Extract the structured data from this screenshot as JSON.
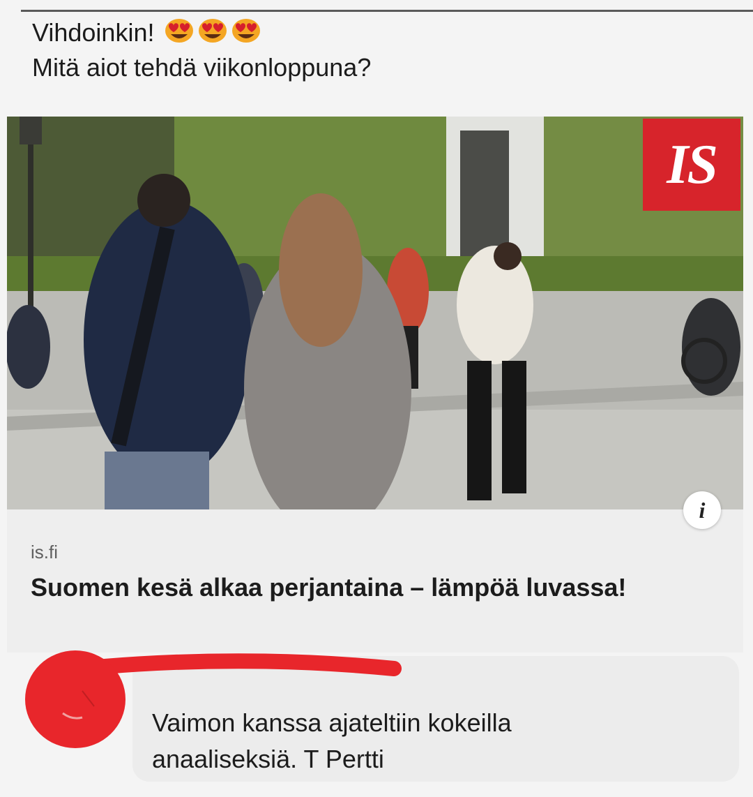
{
  "post": {
    "line1": "Vihdoinkin!",
    "line2": "Mitä aiot tehdä viikonloppuna?",
    "emojis": [
      "heart-eyes-emoji",
      "heart-eyes-emoji",
      "heart-eyes-emoji"
    ]
  },
  "image": {
    "source_logo": "IS",
    "logo_color": "#d7242b"
  },
  "link": {
    "domain": "is.fi",
    "title": "Suomen kesä alkaa perjantaina – lämpöä luvassa!",
    "info_icon": "i"
  },
  "comment": {
    "author": "",
    "text_line1": "Vaimon kanssa ajateltiin kokeilla",
    "text_line2": "anaaliseksiä. T Pertti"
  }
}
